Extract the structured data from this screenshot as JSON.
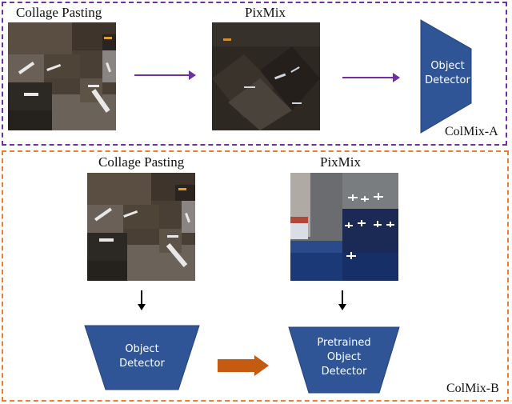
{
  "colmix_a": {
    "collage_title": "Collage Pasting",
    "pixmix_title": "PixMix",
    "detector_label_line1": "Object",
    "detector_label_line2": "Detector",
    "caption": "ColMix-A",
    "border_color": "#7030a0",
    "arrow_color": "#7030a0"
  },
  "colmix_b": {
    "collage_title": "Collage Pasting",
    "pixmix_title": "PixMix",
    "detector_label_line1": "Object",
    "detector_label_line2": "Detector",
    "pretrained_label_line1": "Pretrained",
    "pretrained_label_line2": "Object",
    "pretrained_label_line3": "Detector",
    "caption": "ColMix-B",
    "border_color": "#ed7d31",
    "arrow_color": "#c55a11"
  },
  "detector_color": "#2f5597"
}
